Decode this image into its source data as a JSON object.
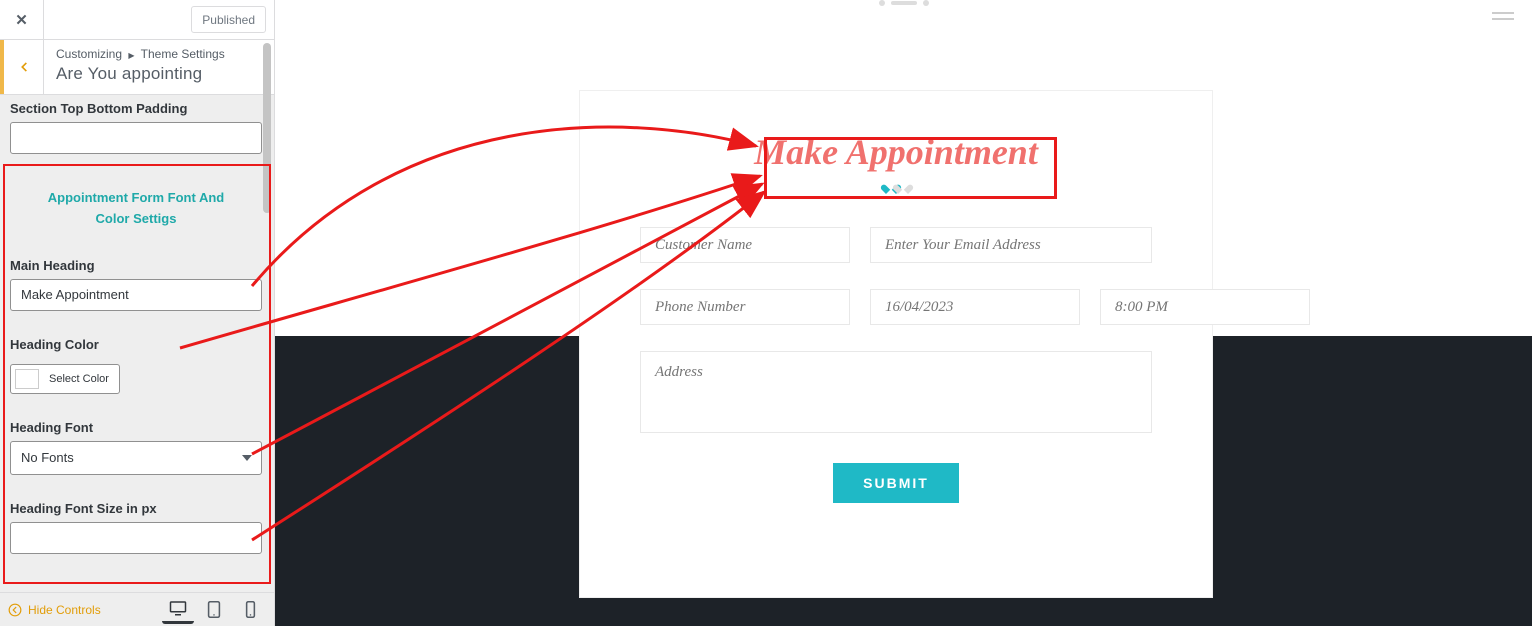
{
  "sidebar": {
    "published_label": "Published",
    "crumb_pre": "Customizing",
    "crumb_post": "Theme Settings",
    "title": "Are You appointing",
    "labels": {
      "padding": "Section Top Bottom Padding",
      "section_title": "Appointment Form Font And Color Settigs",
      "main_heading": "Main Heading",
      "heading_color": "Heading Color",
      "select_color": "Select Color",
      "heading_font": "Heading Font",
      "no_fonts_option": "No Fonts",
      "font_size": "Heading Font Size in px"
    },
    "values": {
      "padding": "",
      "main_heading": "Make Appointment",
      "font_size": ""
    },
    "footer_hide_label": "Hide Controls"
  },
  "form": {
    "heading": "Make Appointment",
    "fields": {
      "customer_name": "Customer Name",
      "email": "Enter Your Email Address",
      "phone": "Phone Number",
      "date": "16/04/2023",
      "time": "8:00 PM",
      "address": "Address"
    },
    "submit": "SUBMIT"
  }
}
